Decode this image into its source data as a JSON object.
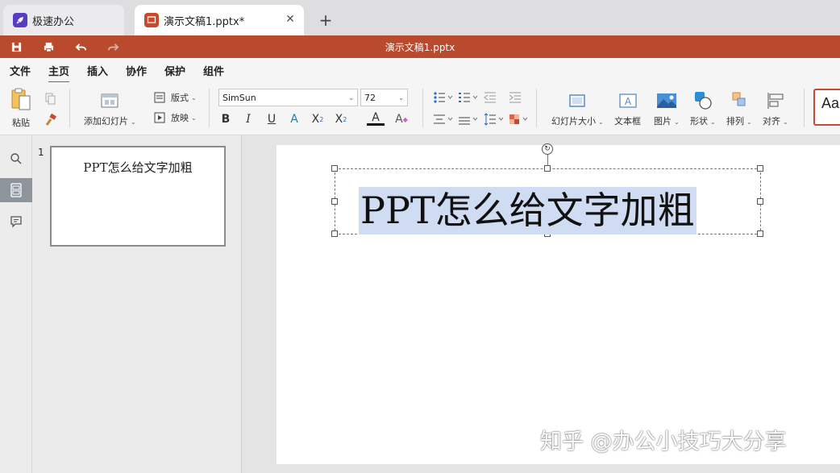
{
  "browser": {
    "tabs": [
      {
        "label": "极速办公",
        "icon": "rocket-icon"
      },
      {
        "label": "演示文稿1.pptx*",
        "icon": "presentation-icon"
      }
    ],
    "new_tab_label": "+"
  },
  "titlebar": {
    "title": "演示文稿1.pptx",
    "color": "#b94a2d",
    "quick": [
      "save-icon",
      "print-icon",
      "undo-icon",
      "redo-icon"
    ]
  },
  "menu": {
    "items": [
      "文件",
      "主页",
      "插入",
      "协作",
      "保护",
      "组件"
    ],
    "active": "主页"
  },
  "ribbon": {
    "paste": "粘贴",
    "add_slide": "添加幻灯片",
    "layout": "版式",
    "play": "放映",
    "font_name": "SimSun",
    "font_size": "72",
    "slide_size": "幻灯片大小",
    "textbox": "文本框",
    "picture": "图片",
    "shape": "形状",
    "arrange": "排列",
    "align": "对齐",
    "theme_preview": "Aa"
  },
  "thumbnails": [
    {
      "number": "1",
      "title": "PPT怎么给文字加粗"
    }
  ],
  "slide": {
    "title": "PPT怎么给文字加粗",
    "selection_color": "#cfdcf2"
  },
  "watermark": "知乎 @办公小技巧大分享"
}
